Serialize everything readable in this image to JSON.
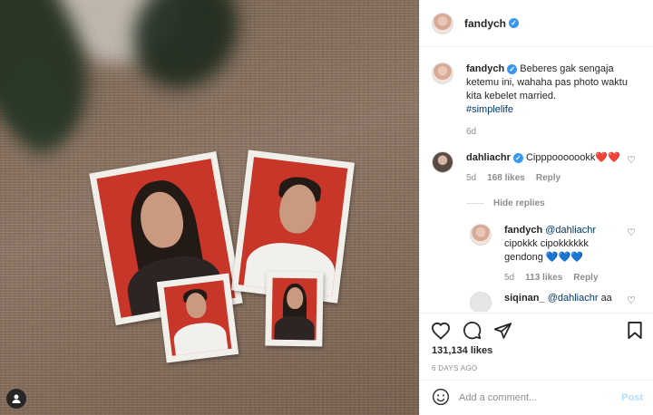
{
  "post": {
    "username": "fandych",
    "caption": "Beberes gak sengaja ketemu ini, wahaha pas photo waktu kita kebelet married.",
    "hashtag": "#simplelife",
    "caption_age": "6d",
    "likes": "131,134 likes",
    "date": "6 DAYS AGO"
  },
  "comments": [
    {
      "username": "dahliachr",
      "text": "Cipppooooookk❤️❤️",
      "age": "5d",
      "likes": "168 likes",
      "reply_label": "Reply"
    }
  ],
  "hide_replies_label": "Hide replies",
  "replies": [
    {
      "username": "fandych",
      "mention": "@dahliachr",
      "text": "cipokkk cipokkkkkk gendong 💙💙💙",
      "age": "5d",
      "likes": "113 likes",
      "reply_label": "Reply"
    },
    {
      "username": "siqinan_",
      "mention": "@dahliachr",
      "text": "aa"
    }
  ],
  "add_comment": {
    "placeholder": "Add a comment...",
    "post_label": "Post"
  },
  "icons": {
    "like": "heart-icon",
    "comment": "comment-icon",
    "share": "share-icon",
    "save": "bookmark-icon",
    "emoji": "emoji-icon",
    "user": "user-icon"
  },
  "colors": {
    "verified": "#3897f0",
    "link": "#00376b",
    "muted": "#8e8e8e",
    "post_disabled": "#b2dffc"
  }
}
